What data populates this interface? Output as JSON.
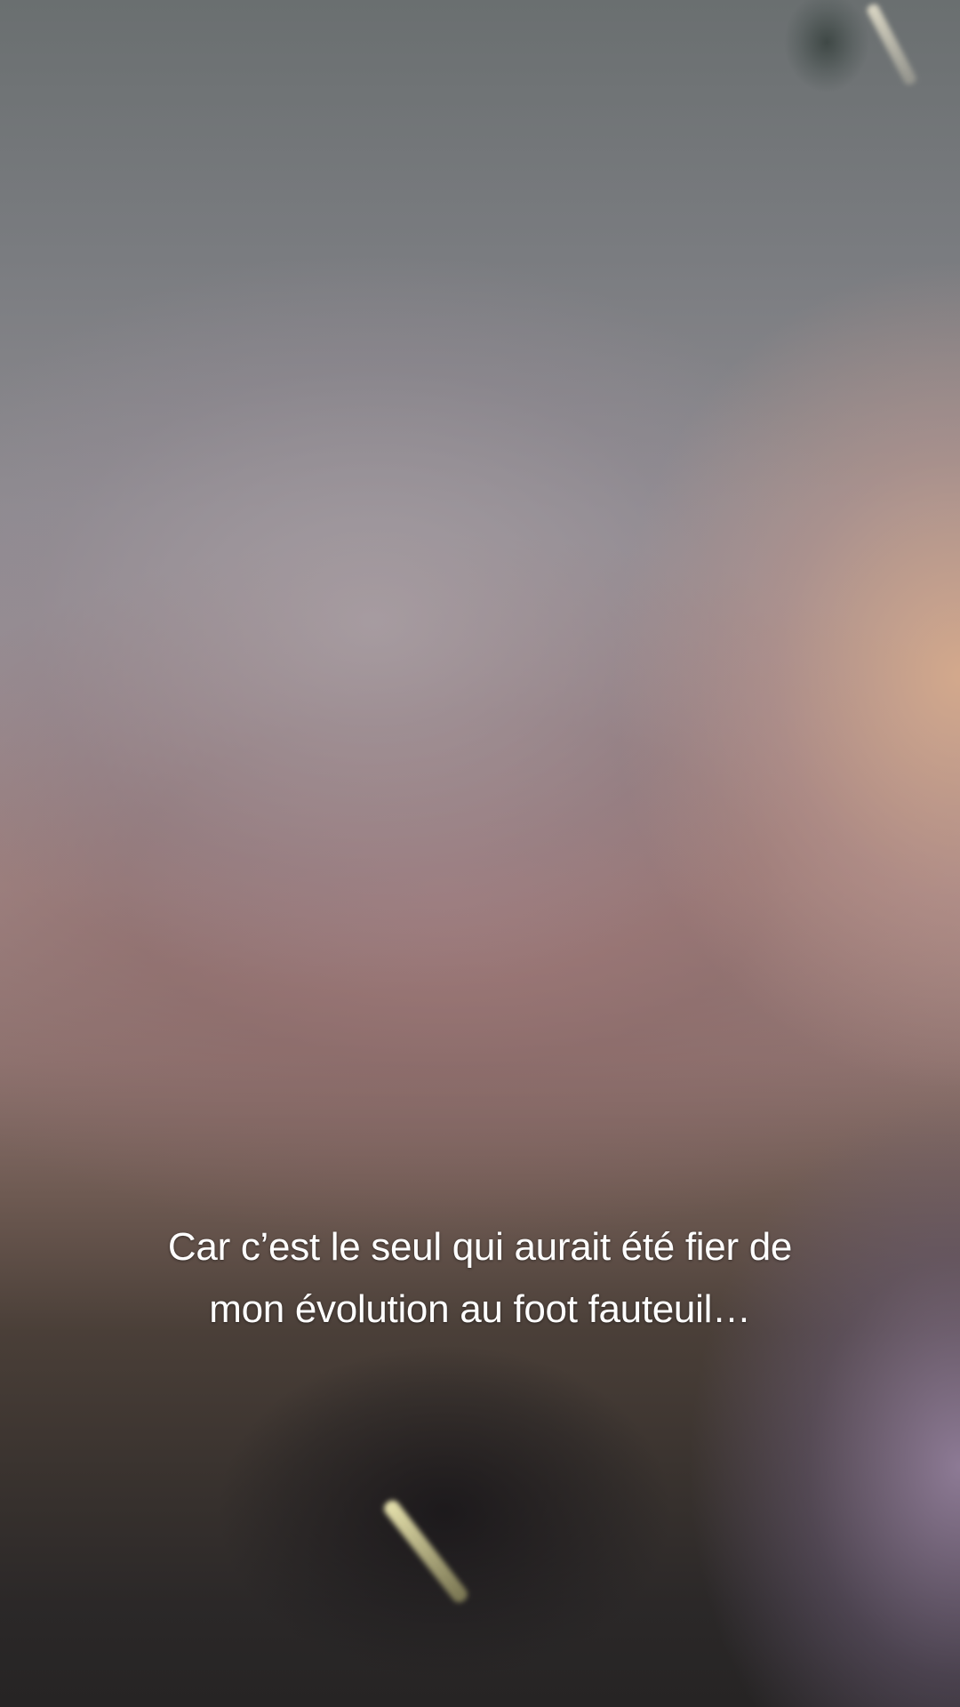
{
  "video": {
    "caption_lines": [
      "Car c’est le seul qui aurait été fier de",
      "mon évolution au foot fauteuil…"
    ]
  }
}
